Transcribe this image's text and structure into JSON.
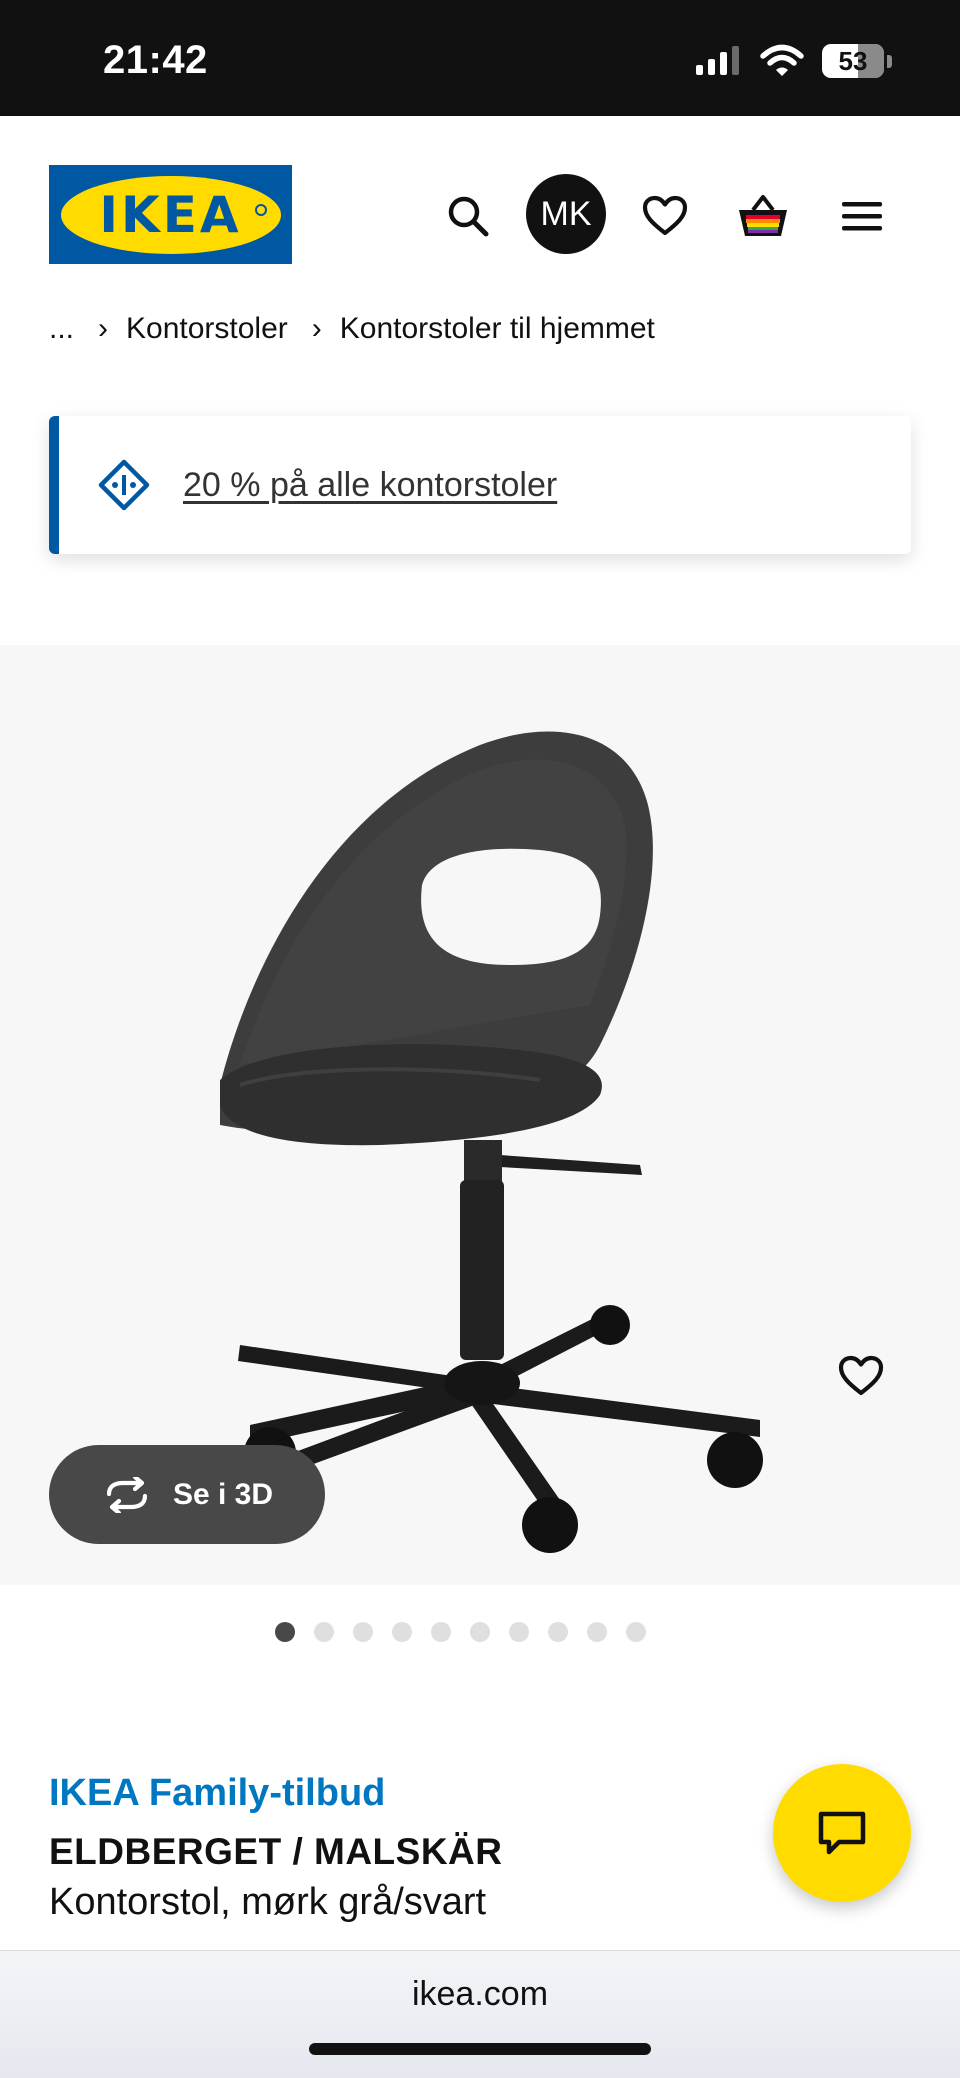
{
  "status_bar": {
    "time": "21:42",
    "battery": "53"
  },
  "header": {
    "logo_text": "IKEA",
    "avatar_initials": "MK",
    "icons": [
      "search-icon",
      "heart-icon",
      "basket-icon",
      "menu-icon"
    ]
  },
  "breadcrumb": {
    "ellipsis": "...",
    "separator": "›",
    "items": [
      "Kontorstoler",
      "Kontorstoler til hjemmet"
    ]
  },
  "promo": {
    "text": "20 % på alle kontorstoler"
  },
  "product_image": {
    "view_3d_label": "Se i 3D",
    "dots_total": 10,
    "dots_active_index": 0
  },
  "product": {
    "offer_label": "IKEA Family-tilbud",
    "name": "ELDBERGET / MALSKÄR",
    "description": "Kontorstol, mørk grå/svart"
  },
  "browser": {
    "url": "ikea.com"
  },
  "colors": {
    "ikea_blue": "#0058a3",
    "ikea_yellow": "#ffdb00",
    "family_blue": "#0077c1",
    "dark_pill": "#484848"
  }
}
